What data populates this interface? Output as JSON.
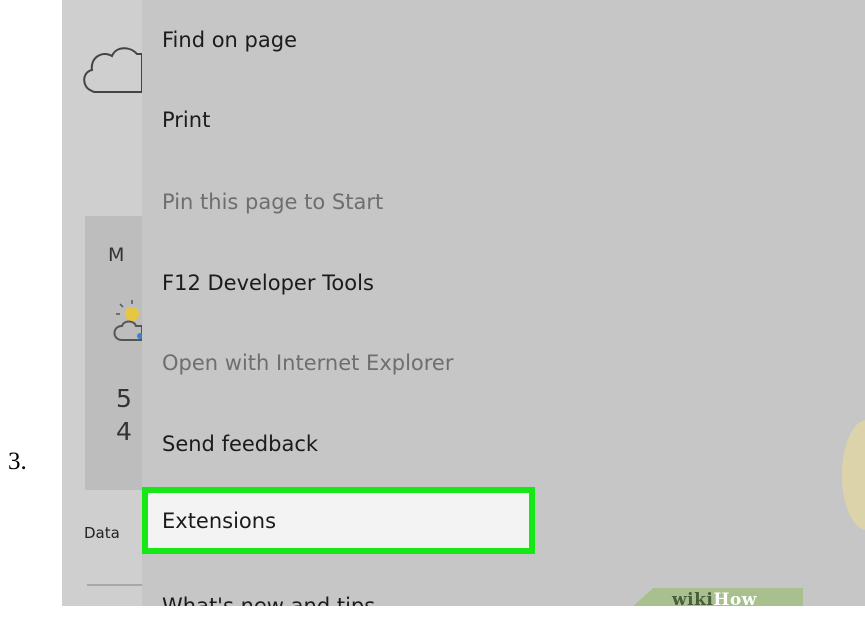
{
  "step_number": "3.",
  "background_page": {
    "weather_letter": "M",
    "temp_high": "5",
    "temp_low": "4",
    "data_label": "Data"
  },
  "menu": {
    "items": [
      {
        "label": "Find on page",
        "enabled": true
      },
      {
        "label": "Print",
        "enabled": true
      },
      {
        "label": "Pin this page to Start",
        "enabled": false
      },
      {
        "label": "F12 Developer Tools",
        "enabled": true
      },
      {
        "label": "Open with Internet Explorer",
        "enabled": false
      },
      {
        "label": "Send feedback",
        "enabled": true
      },
      {
        "label": "Extensions",
        "enabled": true,
        "highlighted": true
      },
      {
        "label": "What's new and tips",
        "enabled": true
      }
    ]
  },
  "watermark": {
    "wiki": "wiki",
    "how": "How"
  },
  "colors": {
    "highlight_border": "#16e816",
    "menu_background": "#c6c6c6"
  },
  "icons": {
    "cloud": "cloud-icon",
    "weather": "partly-sunny-icon"
  }
}
